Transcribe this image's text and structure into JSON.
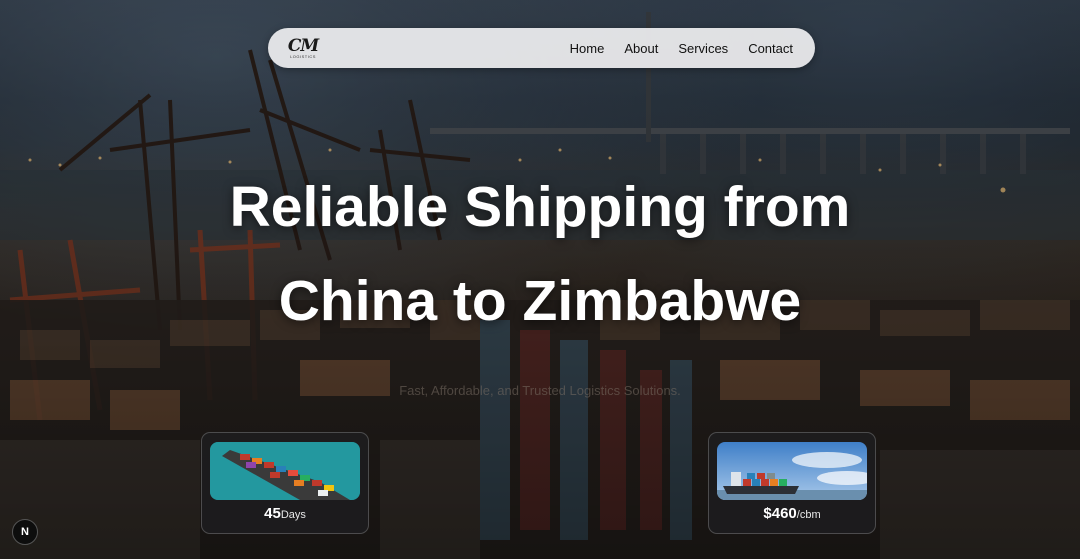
{
  "brand": {
    "logo_mark": "CM",
    "logo_sub": "LOGISTICS"
  },
  "nav": {
    "links": [
      {
        "label": "Home"
      },
      {
        "label": "About"
      },
      {
        "label": "Services"
      },
      {
        "label": "Contact"
      }
    ]
  },
  "hero": {
    "headline_line1": "Reliable Shipping from",
    "headline_line2": "China to Zimbabwe",
    "tagline": "Fast, Affordable, and Trusted Logistics Solutions."
  },
  "stats": [
    {
      "value": "45",
      "unit": "Days"
    },
    {
      "value": "$460",
      "unit": "/cbm"
    }
  ],
  "dev_badge": {
    "label": "N"
  }
}
